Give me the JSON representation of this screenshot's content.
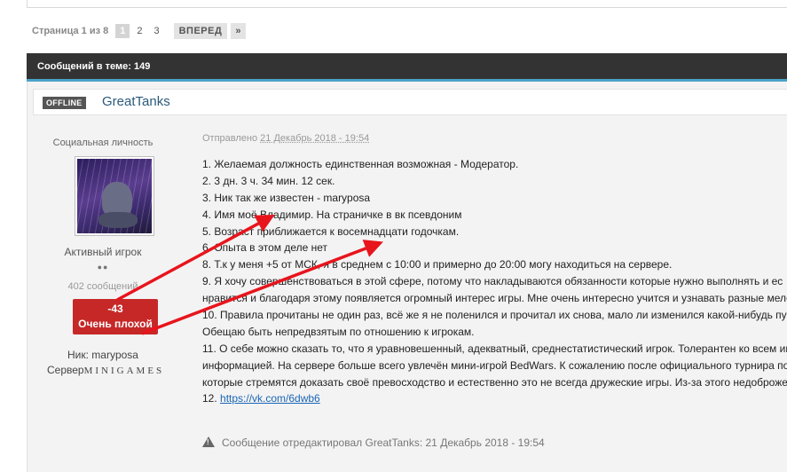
{
  "pagination": {
    "label": "Страница 1 из 8",
    "pages": [
      "1",
      "2",
      "3"
    ],
    "next_label": "ВПЕРЕД",
    "last_label": "»"
  },
  "topic": {
    "count_text": "Сообщений в теме: 149"
  },
  "post": {
    "status_badge": "OFFLINE",
    "author": "GreatTanks",
    "rank_title": "Социальная личность",
    "group": "Активный игрок",
    "pips": "●●",
    "post_count": "402 сообщений",
    "reputation": {
      "value": "-43",
      "label": "Очень плохой",
      "color": "#c62828"
    },
    "nick": "Ник: maryposa",
    "server_label": "Сервер",
    "server_value": "MINIGAMES",
    "sent_prefix": "Отправлено",
    "sent_date": "21 Декабрь 2018 - 19:54",
    "lines": [
      "1. Желаемая должность единственная возможная - Модератор.",
      "2.  3 дн. 3 ч. 34 мин. 12 сек.",
      "3. Ник так же известен - maryposa",
      "4. Имя моё Владимир. На страничке в вк псевдоним",
      "5. Возраст приближается к восемнадцати годочкам.",
      "6. Опыта в этом деле нет",
      "8. Т.к у меня +5 от МСК, я в среднем с 10:00 и примерно до 20:00 могу находиться на сервере.",
      "9.  Я хочу совершенствоваться в этой сфере,  потому что накладываются обязанности которые нужно выполнять и ес",
      "нравится и благодаря этому появляется огромный интерес игры. Мне очень интересно учится и узнавать разные мело",
      "10. Правила прочитаны не один раз, всё же я не поленился и прочитал их снова, мало ли изменился какой-нибудь пун",
      "Обещаю быть непредвзятым по отношению к игрокам.",
      "11. О себе можно сказать то, что я уравновешенный, адекватный, среднестатистический игрок. Толерантен ко всем иг",
      "информацией. На сервере больше всего увлечён мини-игрой BedWars. К сожалению после официального турнира по",
      "которые стремятся доказать своё превосходство и естественно это не всегда дружеские игры. Из-за этого недоброже"
    ],
    "link_prefix": "12.  ",
    "link_text": "https://vk.com/6dwb6",
    "edited_text": "Сообщение отредактировал GreatTanks: 21 Декабрь 2018 - 19:54"
  },
  "annotation_color": "#e8141c"
}
